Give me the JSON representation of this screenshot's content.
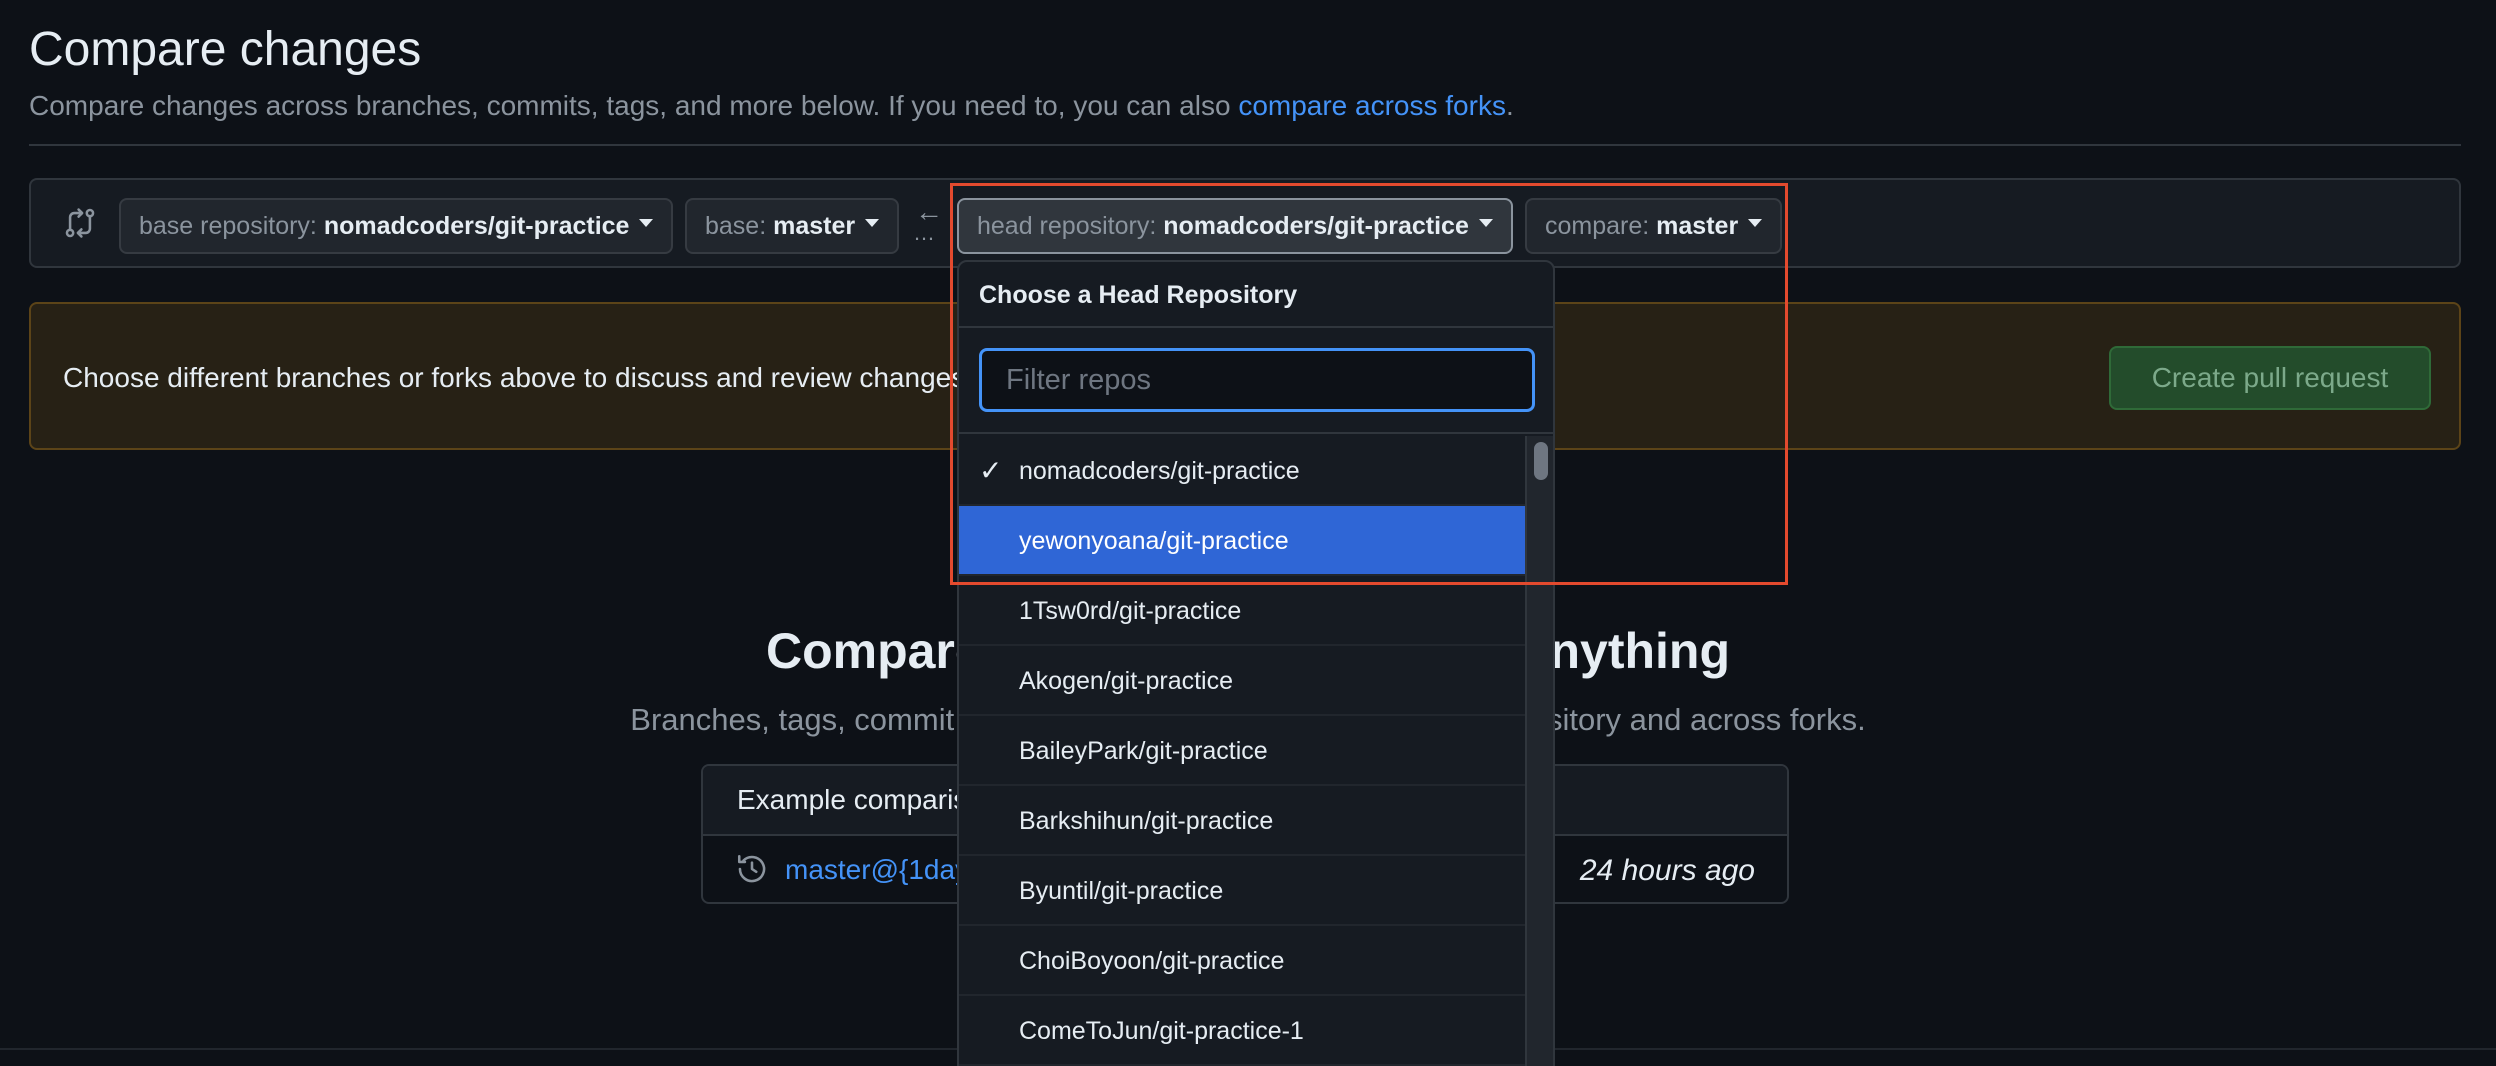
{
  "header": {
    "title": "Compare changes",
    "subtitle": "Compare changes across branches, commits, tags, and more below. If you need to, you can also ",
    "subtitle_link": "compare across forks",
    "subtitle_end": "."
  },
  "range": {
    "base_repo_label": "base repository: ",
    "base_repo_value": "nomadcoders/git-practice",
    "base_label": "base: ",
    "base_value": "master",
    "arrow": "←",
    "dots": "…",
    "head_repo_label": "head repository: ",
    "head_repo_value": "nomadcoders/git-practice",
    "compare_label": "compare: ",
    "compare_value": "master"
  },
  "notice": {
    "text": "Choose different branches or forks above to discuss and review changes.",
    "button": "Create pull request"
  },
  "blankslate": {
    "heading": "Compare and review just about anything",
    "sub": "Branches, tags, commit ranges, and time ranges. In the same repository and across forks."
  },
  "examples": {
    "header": "Example comparisons",
    "link": "master@{1day}...master",
    "time": "24 hours ago"
  },
  "dropdown": {
    "title": "Choose a Head Repository",
    "filter_placeholder": "Filter repos",
    "check": "✓",
    "items": [
      "nomadcoders/git-practice",
      "yewonyoana/git-practice",
      "1Tsw0rd/git-practice",
      "Akogen/git-practice",
      "BaileyPark/git-practice",
      "Barkshihun/git-practice",
      "Byuntil/git-practice",
      "ChoiBoyoon/git-practice",
      "ComeToJun/git-practice-1"
    ]
  },
  "colors": {
    "accent": "#4493f8",
    "selected": "#2f66d6",
    "highlight": "#e34a2e",
    "create_button": "#234c2b"
  }
}
